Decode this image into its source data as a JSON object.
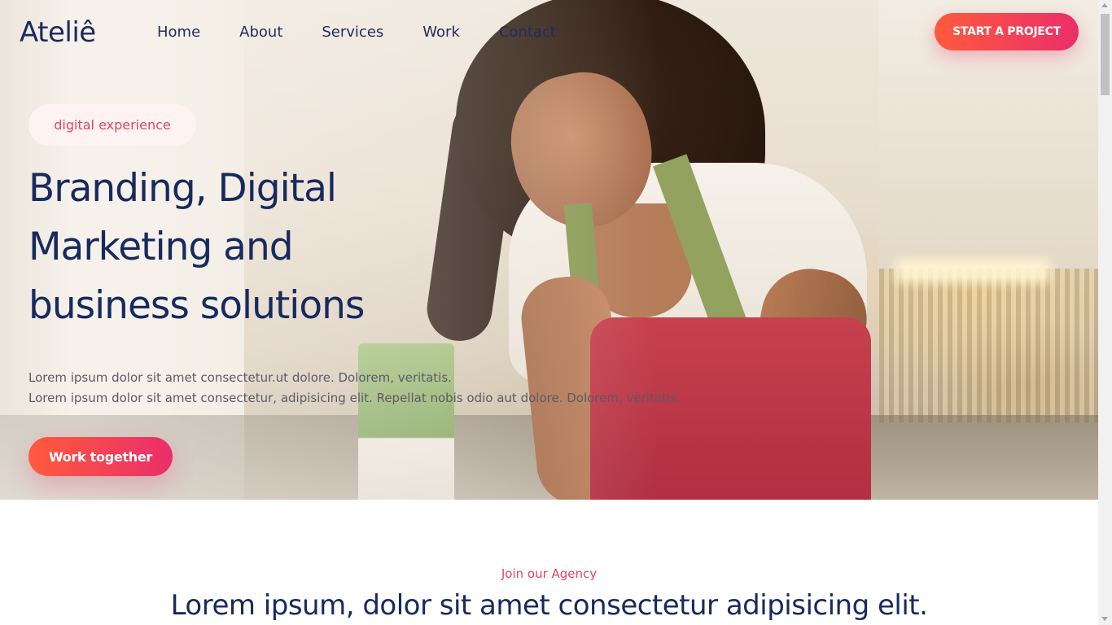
{
  "brand": {
    "logo": "Ateliê"
  },
  "nav": {
    "items": [
      {
        "label": "Home"
      },
      {
        "label": "About"
      },
      {
        "label": "Services"
      },
      {
        "label": "Work"
      },
      {
        "label": "Contact"
      }
    ],
    "cta_label": "START A PROJECT"
  },
  "hero": {
    "tag": "digital experience",
    "headline": "Branding, Digital Marketing and business solutions",
    "lead_line1": "Lorem ipsum dolor sit amet consectetur.ut dolore. Dolorem, veritatis.",
    "lead_line2": "Lorem ipsum dolor sit amet consectetur, adipisicing elit. Repellat nobis odio aut dolore. Dolorem, veritatis.",
    "button_label": "Work together"
  },
  "agency": {
    "eyebrow": "Join our Agency",
    "title": "Lorem ipsum, dolor sit amet consectetur adipisicing elit."
  },
  "colors": {
    "accent_start": "#ff5a3d",
    "accent_end": "#ea2e6b",
    "navy": "#172a5e",
    "pink_text": "#e8435e"
  }
}
